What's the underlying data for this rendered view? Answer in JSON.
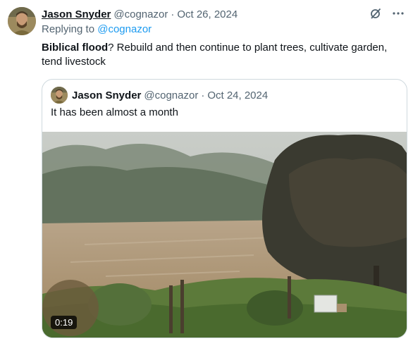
{
  "tweet": {
    "author_name": "Jason Snyder",
    "handle": "@cognazor",
    "separator": "·",
    "date": "Oct 26, 2024",
    "replying_prefix": "Replying to",
    "replying_to": "@cognazor",
    "text_bold": "Biblical flood",
    "text_rest": "? Rebuild and then continue to plant trees, cultivate garden, tend livestock",
    "icons": [
      "grok-icon",
      "more-icon"
    ]
  },
  "quoted_tweet": {
    "author_name": "Jason Snyder",
    "handle": "@cognazor",
    "separator": "·",
    "date": "Oct 24, 2024",
    "text": "It has been almost a month",
    "media": {
      "type": "video",
      "description_icon": "flooded-valley-video-thumbnail",
      "duration": "0:19"
    }
  },
  "colors": {
    "text": "#0f1419",
    "muted": "#536471",
    "link": "#1d9bf0",
    "border": "#cfd9de"
  }
}
